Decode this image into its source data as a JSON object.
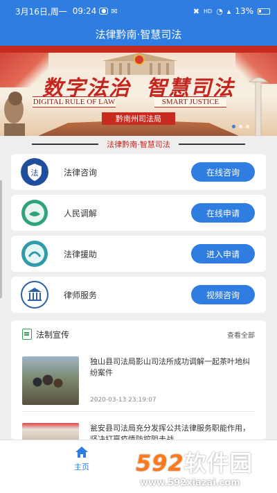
{
  "status_bar": {
    "date_time": "3月16日,周一",
    "time": "09:24",
    "network": "HD",
    "battery": "13%"
  },
  "app_title": "法律黔南·智慧司法",
  "banner": {
    "headline_left": "数字法治",
    "headline_right": "智慧司法",
    "english_left": "DIGITAL RULE OF LAW",
    "english_right": "SMART JUSTICE",
    "department": "黔南州司法局",
    "slides": 3,
    "active_slide": 1
  },
  "section_title": "法律黔南·智慧司法",
  "services": [
    {
      "label": "法律咨询",
      "button": "在线咨询",
      "icon": "law-shield-icon"
    },
    {
      "label": "人民调解",
      "button": "在线申请",
      "icon": "handshake-icon"
    },
    {
      "label": "法律援助",
      "button": "进入申请",
      "icon": "legal-aid-icon"
    },
    {
      "label": "律师服务",
      "button": "视频咨询",
      "icon": "courthouse-icon"
    }
  ],
  "news": {
    "title": "法制宣传",
    "view_all": "查看全部",
    "items": [
      {
        "headline": "独山县司法局影山司法所成功调解一起茶叶地纠纷案件",
        "date": "2020-03-13 23:19:07"
      },
      {
        "headline": "瓮安县司法局充分发挥公共法律服务职能作用，坚决打赢疫情防控阻击战",
        "date": ""
      }
    ]
  },
  "tabbar": {
    "home_label": "主页"
  },
  "watermark": {
    "brand_num": "592",
    "brand_text": "软件园",
    "url": "www.592xiazai.com"
  },
  "colors": {
    "primary": "#2f7de1",
    "accent_red": "#c3261f",
    "background": "#eeeeee"
  }
}
